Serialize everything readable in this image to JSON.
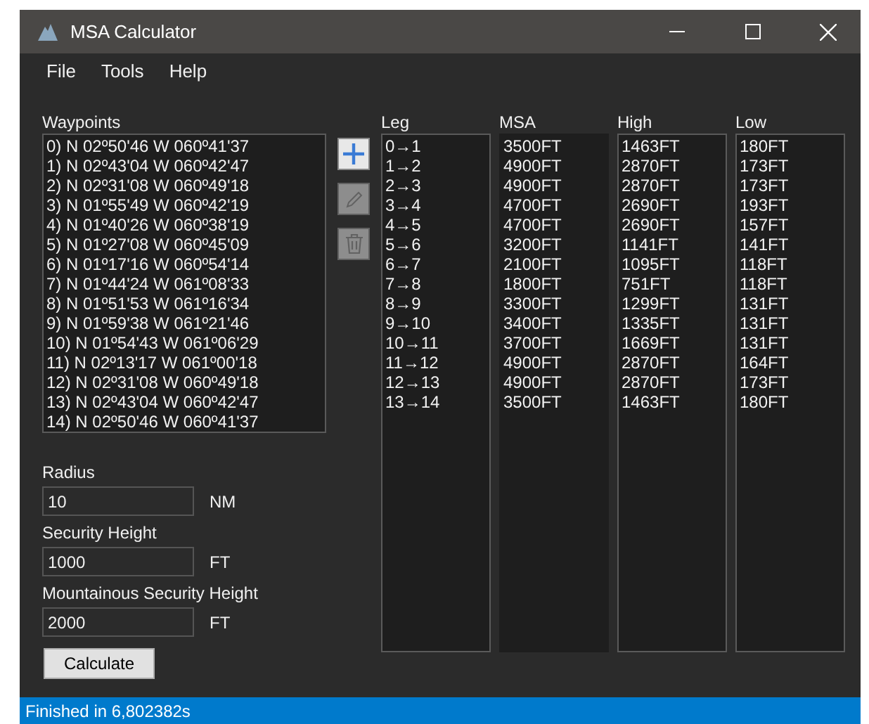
{
  "window": {
    "title": "MSA Calculator"
  },
  "menu": [
    "File",
    "Tools",
    "Help"
  ],
  "waypoints": {
    "label": "Waypoints",
    "items": [
      "0) N 02º50'46 W 060º41'37",
      "1) N 02º43'04 W 060º42'47",
      "2) N 02º31'08 W 060º49'18",
      "3) N 01º55'49 W 060º42'19",
      "4) N 01º40'26 W 060º38'19",
      "5) N 01º27'08 W 060º45'09",
      "6) N 01º17'16 W 060º54'14",
      "7) N 01º44'24 W 061º08'33",
      "8) N 01º51'53 W 061º16'34",
      "9) N 01º59'38 W 061º21'46",
      "10) N 01º54'43 W 061º06'29",
      "11) N 02º13'17 W 061º00'18",
      "12) N 02º31'08 W 060º49'18",
      "13) N 02º43'04 W 060º42'47",
      "14) N 02º50'46 W 060º41'37"
    ]
  },
  "tool_buttons": [
    {
      "kind": "add",
      "disabled": false
    },
    {
      "kind": "edit",
      "disabled": true
    },
    {
      "kind": "delete",
      "disabled": true
    }
  ],
  "fields": [
    {
      "label": "Radius",
      "value": "10",
      "unit": "NM"
    },
    {
      "label": "Security Height",
      "value": "1000",
      "unit": "FT"
    },
    {
      "label": "Mountainous Security Height",
      "value": "2000",
      "unit": "FT"
    }
  ],
  "calculate_button": "Calculate",
  "results": [
    {
      "label": "Leg",
      "focused": false,
      "items": [
        "0→1",
        "1→2",
        "2→3",
        "3→4",
        "4→5",
        "5→6",
        "6→7",
        "7→8",
        "8→9",
        "9→10",
        "10→11",
        "11→12",
        "12→13",
        "13→14"
      ]
    },
    {
      "label": "MSA",
      "focused": true,
      "items": [
        "3500FT",
        "4900FT",
        "4900FT",
        "4700FT",
        "4700FT",
        "3200FT",
        "2100FT",
        "1800FT",
        "3300FT",
        "3400FT",
        "3700FT",
        "4900FT",
        "4900FT",
        "3500FT"
      ]
    },
    {
      "label": "High",
      "focused": false,
      "items": [
        "1463FT",
        "2870FT",
        "2870FT",
        "2690FT",
        "2690FT",
        "1141FT",
        "1095FT",
        "751FT",
        "1299FT",
        "1335FT",
        "1669FT",
        "2870FT",
        "2870FT",
        "1463FT"
      ]
    },
    {
      "label": "Low",
      "focused": false,
      "items": [
        "180FT",
        "173FT",
        "173FT",
        "193FT",
        "157FT",
        "141FT",
        "118FT",
        "118FT",
        "131FT",
        "131FT",
        "131FT",
        "164FT",
        "173FT",
        "180FT"
      ]
    }
  ],
  "status_bar": "Finished in 6,802382s"
}
